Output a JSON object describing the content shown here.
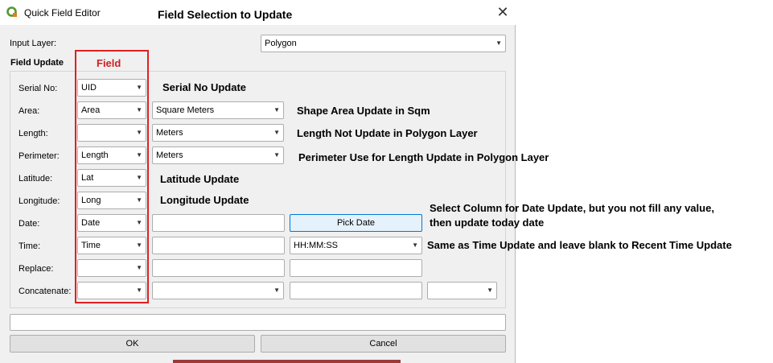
{
  "window": {
    "title": "Quick Field Editor",
    "close": "✕"
  },
  "input_layer": {
    "label": "Input Layer:",
    "value": "Polygon"
  },
  "field_update_label": "Field Update",
  "rows": {
    "serial": {
      "label": "Serial No:",
      "field": "UID"
    },
    "area": {
      "label": "Area:",
      "field": "Area",
      "unit": "Square Meters"
    },
    "length": {
      "label": "Length:",
      "field": "",
      "unit": "Meters"
    },
    "perimeter": {
      "label": "Perimeter:",
      "field": "Length",
      "unit": "Meters"
    },
    "latitude": {
      "label": "Latitude:",
      "field": "Lat"
    },
    "longitude": {
      "label": "Longitude:",
      "field": "Long"
    },
    "date": {
      "label": "Date:",
      "field": "Date",
      "value": "",
      "button": "Pick Date"
    },
    "time": {
      "label": "Time:",
      "field": "Time",
      "value": "",
      "format": "HH:MM:SS"
    },
    "replace": {
      "label": "Replace:",
      "field": "",
      "find": "",
      "replace_with": ""
    },
    "concatenate": {
      "label": "Concatenate:",
      "field": "",
      "field2": "",
      "separator": "",
      "field3": ""
    }
  },
  "status_field": "",
  "buttons": {
    "ok": "OK",
    "cancel": "Cancel"
  },
  "annotations": {
    "heading": "Field Selection to Update",
    "field_box": "Field",
    "serial": "Serial No Update",
    "area": "Shape Area Update in Sqm",
    "length": "Length Not Update in Polygon Layer",
    "perimeter": "Perimeter Use for Length Update in Polygon Layer",
    "latitude": "Latitude Update",
    "longitude": "Longitude Update",
    "date_line1": "Select Column for Date Update, but you not fill any value,",
    "date_line2": "then update today date",
    "time": "Same as Time Update and leave blank to Recent Time Update"
  },
  "colors": {
    "accent_red": "#e02020",
    "button_focus": "#0078d7",
    "qgis_green": "#589632"
  }
}
